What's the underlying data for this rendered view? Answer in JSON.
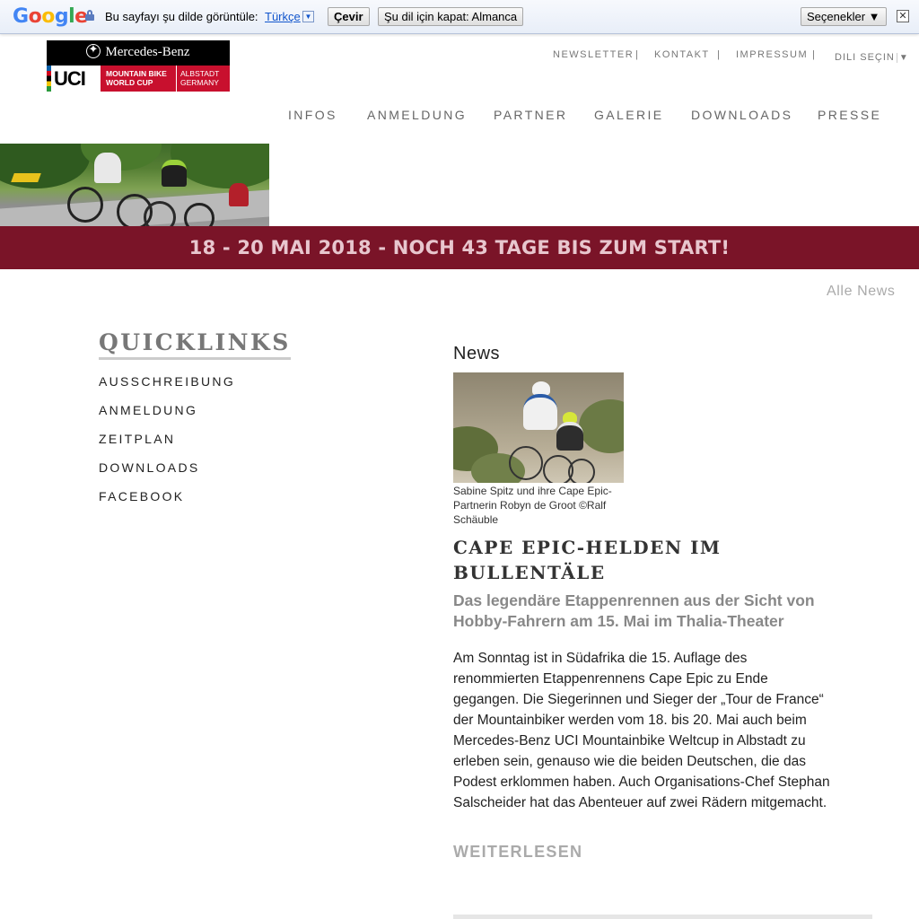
{
  "translate_bar": {
    "logo": [
      "G",
      "o",
      "o",
      "g",
      "l",
      "e"
    ],
    "prompt": "Bu sayfayı şu dilde görüntüle:",
    "language": "Türkçe",
    "translate_button": "Çevir",
    "turn_off_button": "Şu dil için kapat: Almanca",
    "options_button": "Seçenekler ▼",
    "close": "✕"
  },
  "logo": {
    "brand": "Mercedes-Benz",
    "uci": "UCI",
    "line1": "MOUNTAIN BIKE",
    "line2": "WORLD CUP",
    "place1": "ALBSTADT",
    "place2": "GERMANY"
  },
  "top_nav": [
    "NEWSLETTER",
    "KONTAKT",
    "IMPRESSUM"
  ],
  "separator": "|",
  "language_select": "DILI SEÇIN",
  "language_arrow": "▼",
  "main_nav": [
    "INFOS",
    "ANMELDUNG",
    "PARTNER",
    "GALERIE",
    "DOWNLOADS",
    "PRESSE"
  ],
  "banner": "18 - 20 MAI 2018 - NOCH 43 TAGE BIS ZUM START!",
  "all_news": "Alle News",
  "quicklinks": {
    "title": "QUICKLINKS",
    "items": [
      "AUSSCHREIBUNG",
      "ANMELDUNG",
      "ZEITPLAN",
      "DOWNLOADS",
      "FACEBOOK"
    ]
  },
  "news": {
    "heading": "News",
    "caption": "Sabine Spitz und ihre Cape Epic-Partnerin Robyn de Groot ©Ralf Schäuble",
    "title": "CAPE EPIC-HELDEN IM BULLENTÄLE",
    "subtitle": "Das legendäre Etappenrennen aus der Sicht von Hobby-Fahrern am 15. Mai im Thalia-Theater",
    "body": "Am Sonntag ist in Südafrika die 15. Auflage des renommierten Etappenrennens Cape Epic zu Ende gegangen. Die Siegerinnen und Sieger der „Tour de France“ der Mountainbiker werden vom 18. bis 20. Mai auch beim Mercedes-Benz UCI Mountainbike Weltcup in Albstadt zu erleben sein, genauso wie die beiden Deutschen, die das Podest erklommen haben. Auch Organisations-Chef Stephan Salscheider hat das Abenteuer auf zwei Rädern mitgemacht.",
    "read_more": "WEITERLESEN"
  },
  "colors": {
    "banner_bg": "#7a1428",
    "banner_text": "#e8c6ce",
    "nav_text": "#666666",
    "muted": "#aaaaaa"
  }
}
